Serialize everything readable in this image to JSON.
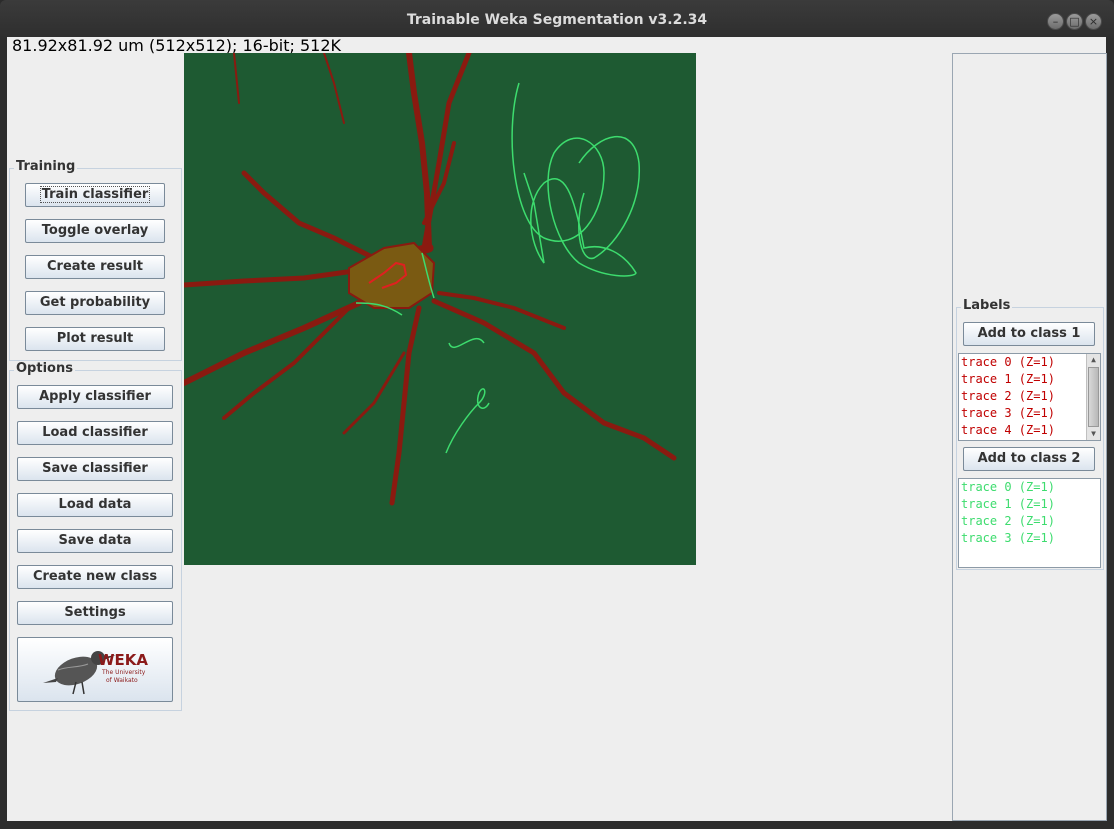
{
  "window": {
    "title": "Trainable Weka Segmentation v3.2.34",
    "controls": {
      "minimize": "–",
      "maximize": "□",
      "close": "×"
    }
  },
  "image_info": "81.92x81.92 um (512x512); 16-bit; 512K",
  "training": {
    "title": "Training",
    "buttons": [
      "Train classifier",
      "Toggle overlay",
      "Create result",
      "Get probability",
      "Plot result"
    ]
  },
  "options": {
    "title": "Options",
    "buttons": [
      "Apply classifier",
      "Load classifier",
      "Save classifier",
      "Load data",
      "Save data",
      "Create new class",
      "Settings"
    ]
  },
  "weka_logo": {
    "text": "WEKA",
    "subtitle1": "The University",
    "subtitle2": "of Waikato"
  },
  "labels": {
    "title": "Labels",
    "class1": {
      "button": "Add to class 1",
      "color": "#c00000",
      "traces": [
        "trace 0 (Z=1)",
        "trace 1 (Z=1)",
        "trace 2 (Z=1)",
        "trace 3 (Z=1)",
        "trace 4 (Z=1)"
      ]
    },
    "class2": {
      "button": "Add to class 2",
      "color": "#3ddc6e",
      "traces": [
        "trace 0 (Z=1)",
        "trace 1 (Z=1)",
        "trace 2 (Z=1)",
        "trace 3 (Z=1)"
      ]
    }
  },
  "colors": {
    "canvas_bg": "#1e5a32",
    "neuron": "#8a1a10",
    "trace_green": "#3ddc6e",
    "trace_red": "#e02020"
  }
}
